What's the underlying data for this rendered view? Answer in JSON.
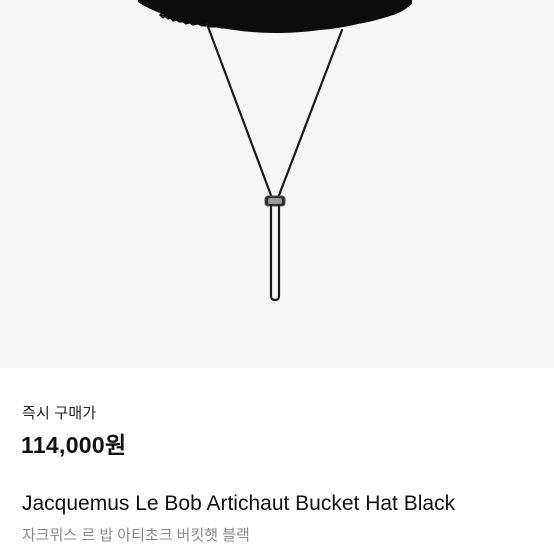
{
  "product": {
    "price_label": "즉시 구매가",
    "price": "114,000원",
    "title": "Jacquemus Le Bob Artichaut Bucket Hat Black",
    "subtitle": "자크뮈스 르 밥 아티초크 버킷햇 블랙"
  },
  "colors": {
    "image_background": "#f6f6f6",
    "hat": "#0d0d0d",
    "strap": "#1a1a1a",
    "subtitle": "#8a8a8a"
  }
}
